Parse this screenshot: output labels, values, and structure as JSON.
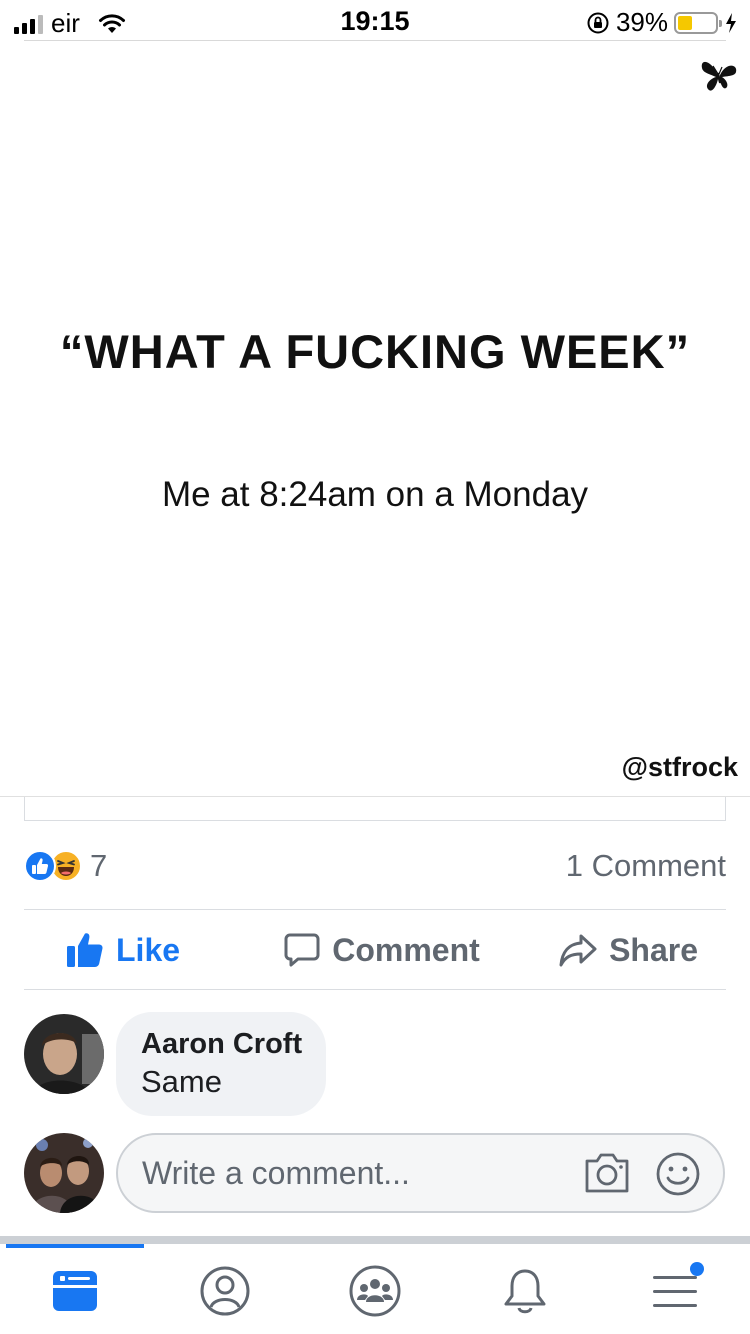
{
  "status_bar": {
    "carrier": "eir",
    "time": "19:15",
    "battery_percent": "39%",
    "battery_level": 0.39,
    "battery_color": "#f5c800"
  },
  "post_image": {
    "quote": "“WHAT A FUCKING WEEK”",
    "caption": "Me at 8:24am on a Monday",
    "watermark": "@stfrock",
    "logo_icon": "butterfly-icon"
  },
  "reactions": {
    "icons": [
      "like-reaction-icon",
      "haha-reaction-icon"
    ],
    "count": "7",
    "comments_label": "1 Comment"
  },
  "actions": {
    "like_label": "Like",
    "comment_label": "Comment",
    "share_label": "Share",
    "accent_color": "#1877f2"
  },
  "comments": [
    {
      "author": "Aaron Croft",
      "text": "Same"
    }
  ],
  "composer": {
    "placeholder": "Write a comment...",
    "icons": [
      "camera-icon",
      "emoji-icon"
    ]
  },
  "tab_bar": {
    "tabs": [
      "news-feed-icon",
      "profile-icon",
      "groups-icon",
      "notifications-icon",
      "menu-icon"
    ],
    "active_tab": "news-feed-icon"
  }
}
